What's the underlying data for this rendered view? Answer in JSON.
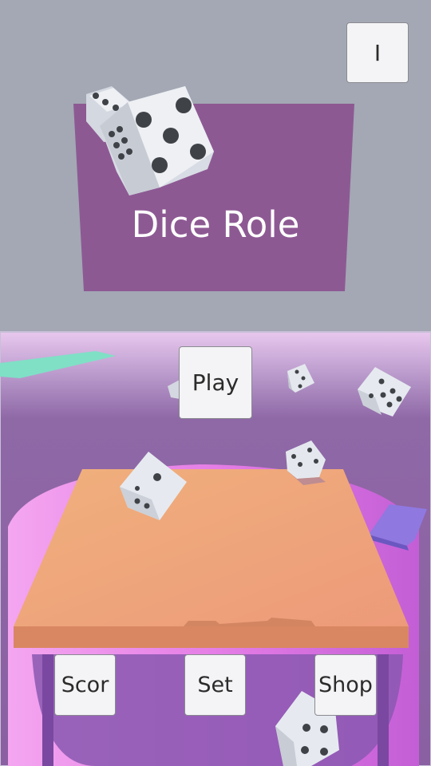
{
  "title": {
    "text": "Dice Role"
  },
  "buttons": {
    "info": "I",
    "play": "Play",
    "score": "Scor",
    "settings": "Set",
    "shop": "Shop"
  },
  "colors": {
    "sky": "#a3a8b4",
    "title_panel": "#8d5993",
    "arena_bg": "#8e66a6",
    "arena_top_glow": "#e6c6ec",
    "table_top": "#f3a877",
    "table_edge": "#e08a63",
    "pedestal": "#e98ae8",
    "dice": "#e8ecf2",
    "pips": "#3f4247",
    "teal_tile": "#7fe0c6",
    "violet_tile": "#8f78e0"
  }
}
